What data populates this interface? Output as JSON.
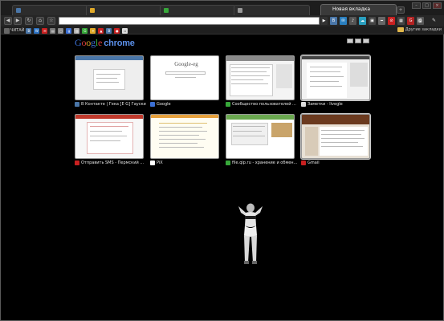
{
  "tabs": [
    {
      "label": "",
      "favicon_color": "#4a76a8",
      "active": false
    },
    {
      "label": "",
      "favicon_color": "#e0a928",
      "active": false
    },
    {
      "label": "",
      "favicon_color": "#37a83a",
      "active": false
    },
    {
      "label": "",
      "favicon_color": "#999999",
      "active": false
    },
    {
      "label": "Новая вкладка",
      "favicon_color": "#3a3a3a",
      "active": true
    }
  ],
  "new_tab_symbol": "+",
  "window_controls": [
    "–",
    "□",
    "×"
  ],
  "toolbar": {
    "back_symbol": "◀",
    "forward_symbol": "▶",
    "reload_symbol": "↻",
    "home_symbol": "⌂",
    "star_symbol": "☆",
    "omnibox_value": "",
    "go_symbol": "▶",
    "page_menu_symbol": "▤",
    "wrench_symbol": "✎"
  },
  "extensions": [
    {
      "name": "ext-1",
      "color": "#333333",
      "glyph": "▪"
    },
    {
      "name": "ext-2",
      "color": "#4a76a8",
      "glyph": "В"
    },
    {
      "name": "ext-3",
      "color": "#2a7fbf",
      "glyph": "✉"
    },
    {
      "name": "ext-4",
      "color": "#555555",
      "glyph": "♪"
    },
    {
      "name": "ext-5",
      "color": "#2a9fbf",
      "glyph": "☁"
    },
    {
      "name": "ext-6",
      "color": "#444444",
      "glyph": "▣"
    },
    {
      "name": "ext-7",
      "color": "#666666",
      "glyph": "━"
    },
    {
      "name": "ext-8",
      "color": "#c82020",
      "glyph": "⊘"
    },
    {
      "name": "ext-9",
      "color": "#444444",
      "glyph": "▦"
    },
    {
      "name": "ext-10",
      "color": "#b22222",
      "glyph": "G"
    },
    {
      "name": "ext-11",
      "color": "#555555",
      "glyph": "⎙"
    }
  ],
  "bookmarks": [
    {
      "label": "ЧИТАЙ",
      "color": "#666666",
      "glyph": ""
    },
    {
      "label": "",
      "color": "#4a76a8",
      "glyph": "В"
    },
    {
      "label": "",
      "color": "#2a6fbf",
      "glyph": "W"
    },
    {
      "label": "",
      "color": "#c82020",
      "glyph": "✉"
    },
    {
      "label": "",
      "color": "#777777",
      "glyph": "▤"
    },
    {
      "label": "",
      "color": "#888888",
      "glyph": "▢"
    },
    {
      "label": "",
      "color": "#3b6fd4",
      "glyph": "g"
    },
    {
      "label": "",
      "color": "#aaaaaa",
      "glyph": "▥"
    },
    {
      "label": "",
      "color": "#37a83a",
      "glyph": "G"
    },
    {
      "label": "",
      "color": "#e0a928",
      "glyph": "✦"
    },
    {
      "label": "",
      "color": "#c82020",
      "glyph": "▲"
    },
    {
      "label": "",
      "color": "#4a76a8",
      "glyph": "В"
    },
    {
      "label": "",
      "color": "#c82020",
      "glyph": "●"
    },
    {
      "label": "",
      "color": "#dddddd",
      "glyph": "▫"
    }
  ],
  "other_bookmarks": "Другие закладки",
  "logo": {
    "g1": "G",
    "g2": "o",
    "g3": "o",
    "g4": "g",
    "g5": "l",
    "g6": "e",
    "chrome": "chrome"
  },
  "most_visited": [
    {
      "title": "В Контакте | Гека [Е G] Гауски",
      "favicon": "#4a76a8"
    },
    {
      "title": "Google",
      "favicon": "#3b6fd4"
    },
    {
      "title": "Сообщество пользователей ...",
      "favicon": "#37a83a"
    },
    {
      "title": "Заметки - livegle",
      "favicon": "#dddddd"
    },
    {
      "title": "Отправить SMS - Пермский ...",
      "favicon": "#c82020"
    },
    {
      "title": "PiX",
      "favicon": "#ffffff"
    },
    {
      "title": "file.qip.ru - хранение и обмен...",
      "favicon": "#37a83a"
    },
    {
      "title": "Gmail",
      "favicon": "#c82020"
    }
  ],
  "thumb_google_text": "Google-eg"
}
